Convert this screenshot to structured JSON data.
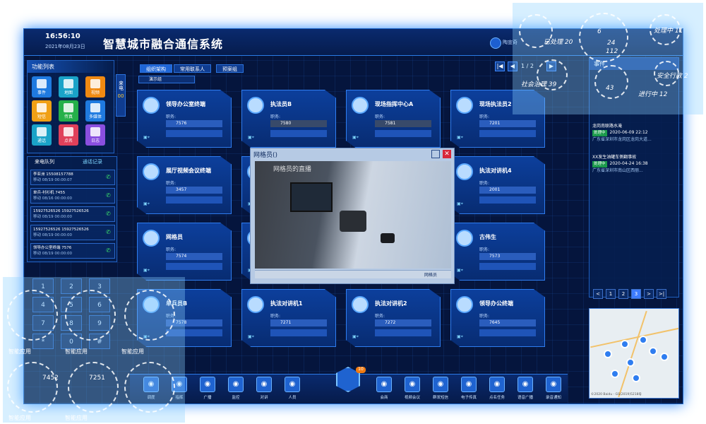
{
  "header": {
    "time": "16:56:10",
    "date": "2021年08月23日",
    "title": "智慧城市融合通信系统",
    "username": "陶宣奇"
  },
  "func_panel": {
    "title": "功能列表",
    "items": [
      {
        "label": "事件",
        "color": "#1f7ae0"
      },
      {
        "label": "地图",
        "color": "#1aa3c8"
      },
      {
        "label": "视频",
        "color": "#f08a12"
      },
      {
        "label": "短信",
        "color": "#f0a015"
      },
      {
        "label": "传真",
        "color": "#25b04a"
      },
      {
        "label": "多媒体",
        "color": "#1f7ae0"
      },
      {
        "label": "通话",
        "color": "#1aa3c8"
      },
      {
        "label": "点名",
        "color": "#e0405a"
      },
      {
        "label": "日志",
        "color": "#8a4fe0"
      }
    ]
  },
  "side_tab": {
    "label": "来电",
    "count": "00"
  },
  "queue": {
    "tab_incoming": "来电队列",
    "tab_records": "通话记录",
    "calls": [
      {
        "l1": "李亚洲    15508157788",
        "l2": "移动    08/19  00:00:07"
      },
      {
        "l1": "单兵-衬衫机    7455",
        "l2": "移动    08/16  00:00:00"
      },
      {
        "l1": "15927526526    15927526526",
        "l2": "移动    08/19  00:00:00"
      },
      {
        "l1": "15927526526    15927526526",
        "l2": "移动    08/19  00:00:00"
      },
      {
        "l1": "领导办公室终端    7576",
        "l2": "移动    08/19  00:00:00"
      }
    ]
  },
  "keypad": {
    "keys": [
      "1",
      "2",
      "3",
      "4",
      "5",
      "6",
      "7",
      "8",
      "9",
      "*",
      "0",
      "#"
    ]
  },
  "tabs": {
    "org": "组织架构",
    "contacts": "常用联系人",
    "presets": "预案组"
  },
  "group": "演示组",
  "pager_top": {
    "page": "1",
    "total": "2"
  },
  "cards": [
    {
      "name": "领导办公室终端",
      "label": "职务:",
      "num": "7576"
    },
    {
      "name": "执法员B",
      "label": "职务:",
      "num": "7580",
      "dark": true
    },
    {
      "name": "现场指挥中心A",
      "label": "职务:",
      "num": "7581",
      "dark": true
    },
    {
      "name": "现场执法员2",
      "label": "职务:",
      "num": "7201"
    },
    {
      "name": "展厅视频会议终端",
      "label": "职务:",
      "num": "3457"
    },
    {
      "name": "",
      "label": "",
      "num": ""
    },
    {
      "name": "",
      "label": "",
      "num": ""
    },
    {
      "name": "执法对讲机4",
      "label": "职务:",
      "num": "2001"
    },
    {
      "name": "网格员",
      "label": "职务:",
      "num": "7574"
    },
    {
      "name": "",
      "label": "",
      "num": ""
    },
    {
      "name": "",
      "label": "",
      "num": ""
    },
    {
      "name": "古伟生",
      "label": "职务:",
      "num": "7573"
    },
    {
      "name": "单兵员B",
      "label": "职务:",
      "num": "7578"
    },
    {
      "name": "执法对讲机1",
      "label": "职务:",
      "num": "7271"
    },
    {
      "name": "执法对讲机2",
      "label": "职务:",
      "num": "7272"
    },
    {
      "name": "领导办公终端",
      "label": "职务:",
      "num": "7645"
    }
  ],
  "video": {
    "title": "网格员()",
    "overlay_text": "网格员的直播",
    "label": "网格员"
  },
  "events": {
    "title": "事件",
    "items": [
      {
        "title": "龙岗南联路水淹",
        "badge": "处理中",
        "time": "2020-06-09 22:12",
        "addr": "广东省深圳市龙岗区龙岗大道..."
      },
      {
        "title": "XX发生油罐车侧翻事故",
        "badge": "处理中",
        "time": "2020-04-24 16:38",
        "addr": "广东省深圳市南山区西丽..."
      }
    ]
  },
  "pager_bottom": [
    "<",
    "1",
    "2",
    "3",
    ">",
    ">|"
  ],
  "dock": {
    "badge": "10",
    "items": [
      "调度",
      "指挥",
      "广播",
      "监控",
      "对讲",
      "人员",
      "会商",
      "视频会议",
      "群发短信",
      "电子传真",
      "点名任务",
      "语音广播",
      "录音通知"
    ]
  },
  "overlay": {
    "stats": [
      {
        "t": "已处理 20"
      },
      {
        "t": "处理中 11"
      },
      {
        "t": "6"
      },
      {
        "t": "24"
      },
      {
        "t": "112"
      },
      {
        "t": "社会治理 39"
      },
      {
        "t": "43"
      },
      {
        "t": "进行中 12"
      },
      {
        "t": "安全行政 2"
      }
    ],
    "apps": [
      "智能应用",
      "智能应用",
      "智能应用",
      "智能应用",
      "智能应用"
    ],
    "nums": [
      "7452",
      "7251"
    ]
  },
  "map_credit": "©2020 Baidu - GS(2019)5218号"
}
